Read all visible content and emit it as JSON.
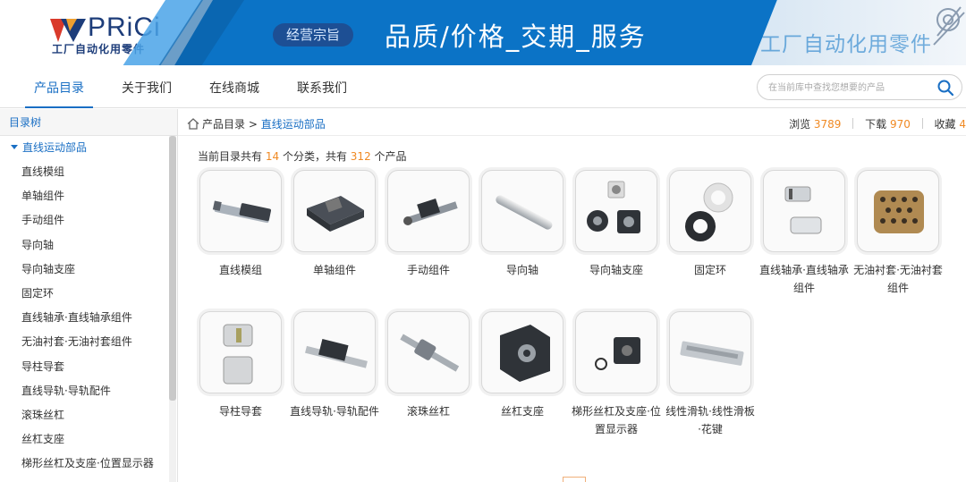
{
  "banner": {
    "logo": "PRiCi",
    "tagline": "工厂自动化用零件",
    "mission_pill": "经营宗旨",
    "slogan": "品质/价格_交期_服务",
    "faded_text": "工厂自动化用零件"
  },
  "nav": {
    "items": [
      {
        "label": "产品目录",
        "active": true
      },
      {
        "label": "关于我们",
        "active": false
      },
      {
        "label": "在线商城",
        "active": false
      },
      {
        "label": "联系我们",
        "active": false
      }
    ],
    "search_placeholder": "在当前库中查找您想要的产品"
  },
  "sidebar": {
    "header": "目录树",
    "root": "直线运动部品",
    "items": [
      "直线模组",
      "单轴组件",
      "手动组件",
      "导向轴",
      "导向轴支座",
      "固定环",
      "直线轴承·直线轴承组件",
      "无油衬套·无油衬套组件",
      "导柱导套",
      "直线导轨·导轨配件",
      "滚珠丝杠",
      "丝杠支座",
      "梯形丝杠及支座·位置显示器"
    ]
  },
  "breadcrumb": {
    "home": "产品目录",
    "separator": ">",
    "current": "直线运动部品"
  },
  "stats": {
    "views_label": "浏览",
    "views": "3789",
    "downloads_label": "下载",
    "downloads": "970",
    "favorites_label": "收藏",
    "favorites": "4"
  },
  "summary": {
    "prefix": "当前目录共有",
    "categories": "14",
    "mid": "个分类，共有",
    "products": "312",
    "suffix": "个产品"
  },
  "products": [
    {
      "label": "直线模组",
      "icon": "linear-module"
    },
    {
      "label": "单轴组件",
      "icon": "single-axis"
    },
    {
      "label": "手动组件",
      "icon": "manual-stage"
    },
    {
      "label": "导向轴",
      "icon": "guide-shaft"
    },
    {
      "label": "导向轴支座",
      "icon": "shaft-support"
    },
    {
      "label": "固定环",
      "icon": "collar-ring"
    },
    {
      "label": "直线轴承·直线轴承组件",
      "icon": "linear-bearing"
    },
    {
      "label": "无油衬套·无油衬套组件",
      "icon": "oilless-bushing"
    },
    {
      "label": "导柱导套",
      "icon": "guide-post"
    },
    {
      "label": "直线导轨·导轨配件",
      "icon": "linear-guide"
    },
    {
      "label": "滚珠丝杠",
      "icon": "ball-screw"
    },
    {
      "label": "丝杠支座",
      "icon": "screw-support"
    },
    {
      "label": "梯形丝杠及支座·位置显示器",
      "icon": "trapezoid-screw"
    },
    {
      "label": "线性滑轨·线性滑板·花键",
      "icon": "linear-slide"
    }
  ],
  "colors": {
    "accent": "#1a6fc4",
    "highlight_number": "#f08a24",
    "banner_blue": "#0b73c6"
  }
}
